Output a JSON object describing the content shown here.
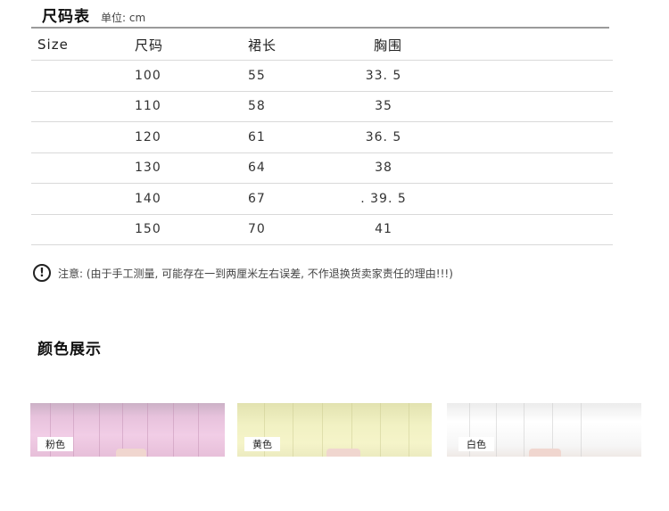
{
  "size_chart": {
    "title": "尺码表",
    "unit": "单位: cm",
    "columns": [
      "Size",
      "尺码",
      "裙长",
      "胸围"
    ],
    "rows": [
      [
        "",
        "100",
        "55",
        "33. 5"
      ],
      [
        "",
        "110",
        "58",
        "35"
      ],
      [
        "",
        "120",
        "61",
        "36. 5"
      ],
      [
        "",
        "130",
        "64",
        "38"
      ],
      [
        "",
        "140",
        "67",
        ". 39. 5"
      ],
      [
        "",
        "150",
        "70",
        "41"
      ]
    ]
  },
  "notice": {
    "icon": "exclamation-circle-icon",
    "icon_glyph": "!",
    "text": "注意: (由于手工测量, 可能存在一到两厘米左右误差, 不作退换货卖家责任的理由!!!)"
  },
  "colors": {
    "title": "颜色展示",
    "items": [
      {
        "label": "粉色",
        "swatch": "#efc9e2"
      },
      {
        "label": "黄色",
        "swatch": "#f3f2c5"
      },
      {
        "label": "白色",
        "swatch": "#ffffff"
      }
    ]
  }
}
